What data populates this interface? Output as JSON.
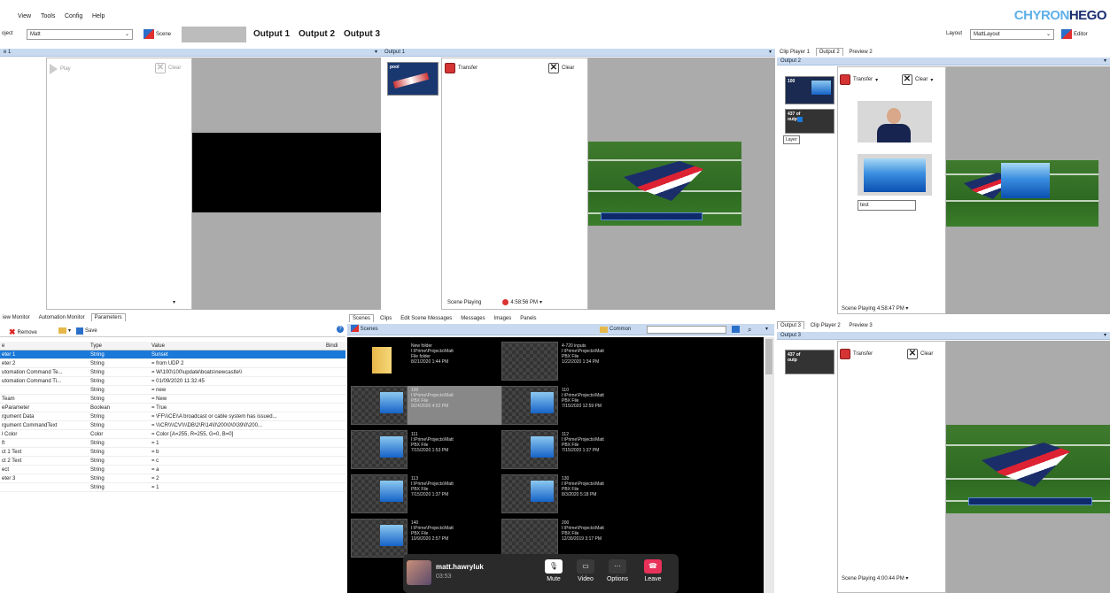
{
  "menu": {
    "items": [
      "View",
      "Tools",
      "Config",
      "Help"
    ]
  },
  "brand": {
    "part1": "CHYRON",
    "part2": "HEGO"
  },
  "project": {
    "label": "oject",
    "value": "Matt"
  },
  "scene_btn": "Scene",
  "outputs_tabs": [
    "Output 1",
    "Output 2",
    "Output 3"
  ],
  "layout": {
    "label": "Layout",
    "value": "MattLayout",
    "editor": "Editor"
  },
  "left_panel": {
    "header": "e 1",
    "play": "Play",
    "clear": "Clear"
  },
  "output1": {
    "header": "Output 1",
    "thumb_label": "pool",
    "transfer": "Transfer",
    "clear": "Clear",
    "status": "Scene Playing",
    "time": "4:58:56 PM"
  },
  "right_top": {
    "tabs": [
      "Clip Player 1",
      "Output 2",
      "Preview 2"
    ],
    "header": "Output 2",
    "thumb1": "100",
    "thumb2_line1": "437 of",
    "thumb2_line2": "outp",
    "tooltip": "Layer",
    "transfer": "Transfer",
    "clear": "Clear",
    "text_field": "test",
    "status": "Scene Playing",
    "time": "4:58:47 PM"
  },
  "right_bottom": {
    "tabs": [
      "Output 3",
      "Clip Player 2",
      "Preview 3"
    ],
    "header": "Output 3",
    "thumb_line1": "437 of",
    "thumb_line2": "outp",
    "transfer": "Transfer",
    "clear": "Clear",
    "status": "Scene Playing",
    "time": "4:00:44 PM"
  },
  "params": {
    "tabs": [
      "iew Monitor",
      "Automation Monitor",
      "Parameters"
    ],
    "remove": "Remove",
    "save": "Save",
    "columns": [
      "e",
      "Type",
      "Value",
      "Bindi"
    ],
    "rows": [
      [
        "eter 1",
        "String",
        "Sunset"
      ],
      [
        "eter 2",
        "String",
        "= from UDP 2"
      ],
      [
        "utomation Command Te...",
        "String",
        "= W\\100\\100\\update\\boats\\newcastle\\\\"
      ],
      [
        "utomation Command Ti...",
        "String",
        "= 01/09/2020 11:32:45"
      ],
      [
        "",
        "String",
        "= new"
      ],
      [
        "Team",
        "String",
        "= New"
      ],
      [
        "eParameter",
        "Boolean",
        "= True"
      ],
      [
        "rgument Data",
        "String",
        "= \\FF\\\\\\CE\\\\A broadcast or cable system has issued..."
      ],
      [
        "rgument CommandText",
        "String",
        "= \\\\\\CR\\\\\\\\CV\\\\\\\\DB\\2\\R\\14\\0\\200\\0\\0\\39\\0\\200..."
      ],
      [
        "l Color",
        "Color",
        "= Color [A=255, R=255, G=0, B=0]"
      ],
      [
        "ft",
        "String",
        "= 1"
      ],
      [
        "ct 1 Text",
        "String",
        "= b"
      ],
      [
        "ct 2 Text",
        "String",
        "= c"
      ],
      [
        "ect",
        "String",
        "= a"
      ],
      [
        "eter 3",
        "String",
        "= 2"
      ],
      [
        "",
        "String",
        "= 1"
      ]
    ]
  },
  "scenes": {
    "tabs": [
      "Scenes",
      "Clips",
      "Edit Scene Messages",
      "Messages",
      "Images",
      "Panels"
    ],
    "root": "Scenes",
    "common": "Common",
    "items": [
      {
        "name": "New folder",
        "path": "I:\\Prime\\Projects\\Matt",
        "type": "File folder",
        "date": "8/21/2020 1:44 PM"
      },
      {
        "name": "4-720 inputs",
        "path": "I:\\Prime\\Projects\\Matt",
        "type": "PBX File",
        "date": "1/22/2020 1:34 PM"
      },
      {
        "name": "100",
        "path": "I:\\Prime\\Projects\\Matt",
        "type": "PBX File",
        "date": "9/24/2020 4:52 PM"
      },
      {
        "name": "110",
        "path": "I:\\Prime\\Projects\\Matt",
        "type": "PBX File",
        "date": "7/15/2020 12:59 PM"
      },
      {
        "name": "111",
        "path": "I:\\Prime\\Projects\\Matt",
        "type": "PBX File",
        "date": "7/15/2020 1:53 PM"
      },
      {
        "name": "112",
        "path": "I:\\Prime\\Projects\\Matt",
        "type": "PBX File",
        "date": "7/15/2020 1:37 PM"
      },
      {
        "name": "113",
        "path": "I:\\Prime\\Projects\\Matt",
        "type": "PBX File",
        "date": "7/15/2020 1:37 PM"
      },
      {
        "name": "130",
        "path": "I:\\Prime\\Projects\\Matt",
        "type": "PBX File",
        "date": "8/3/2020 5:18 PM"
      },
      {
        "name": "140",
        "path": "I:\\Prime\\Projects\\Matt",
        "type": "PBX File",
        "date": "10/9/2020 2:57 PM"
      },
      {
        "name": "200",
        "path": "I:\\Prime\\Projects\\Matt",
        "type": "PBX File",
        "date": "12/30/2019 3:17 PM"
      }
    ]
  },
  "call": {
    "name": "matt.hawryluk",
    "timer": "03:53",
    "mute": "Mute",
    "video": "Video",
    "options": "Options",
    "leave": "Leave"
  }
}
